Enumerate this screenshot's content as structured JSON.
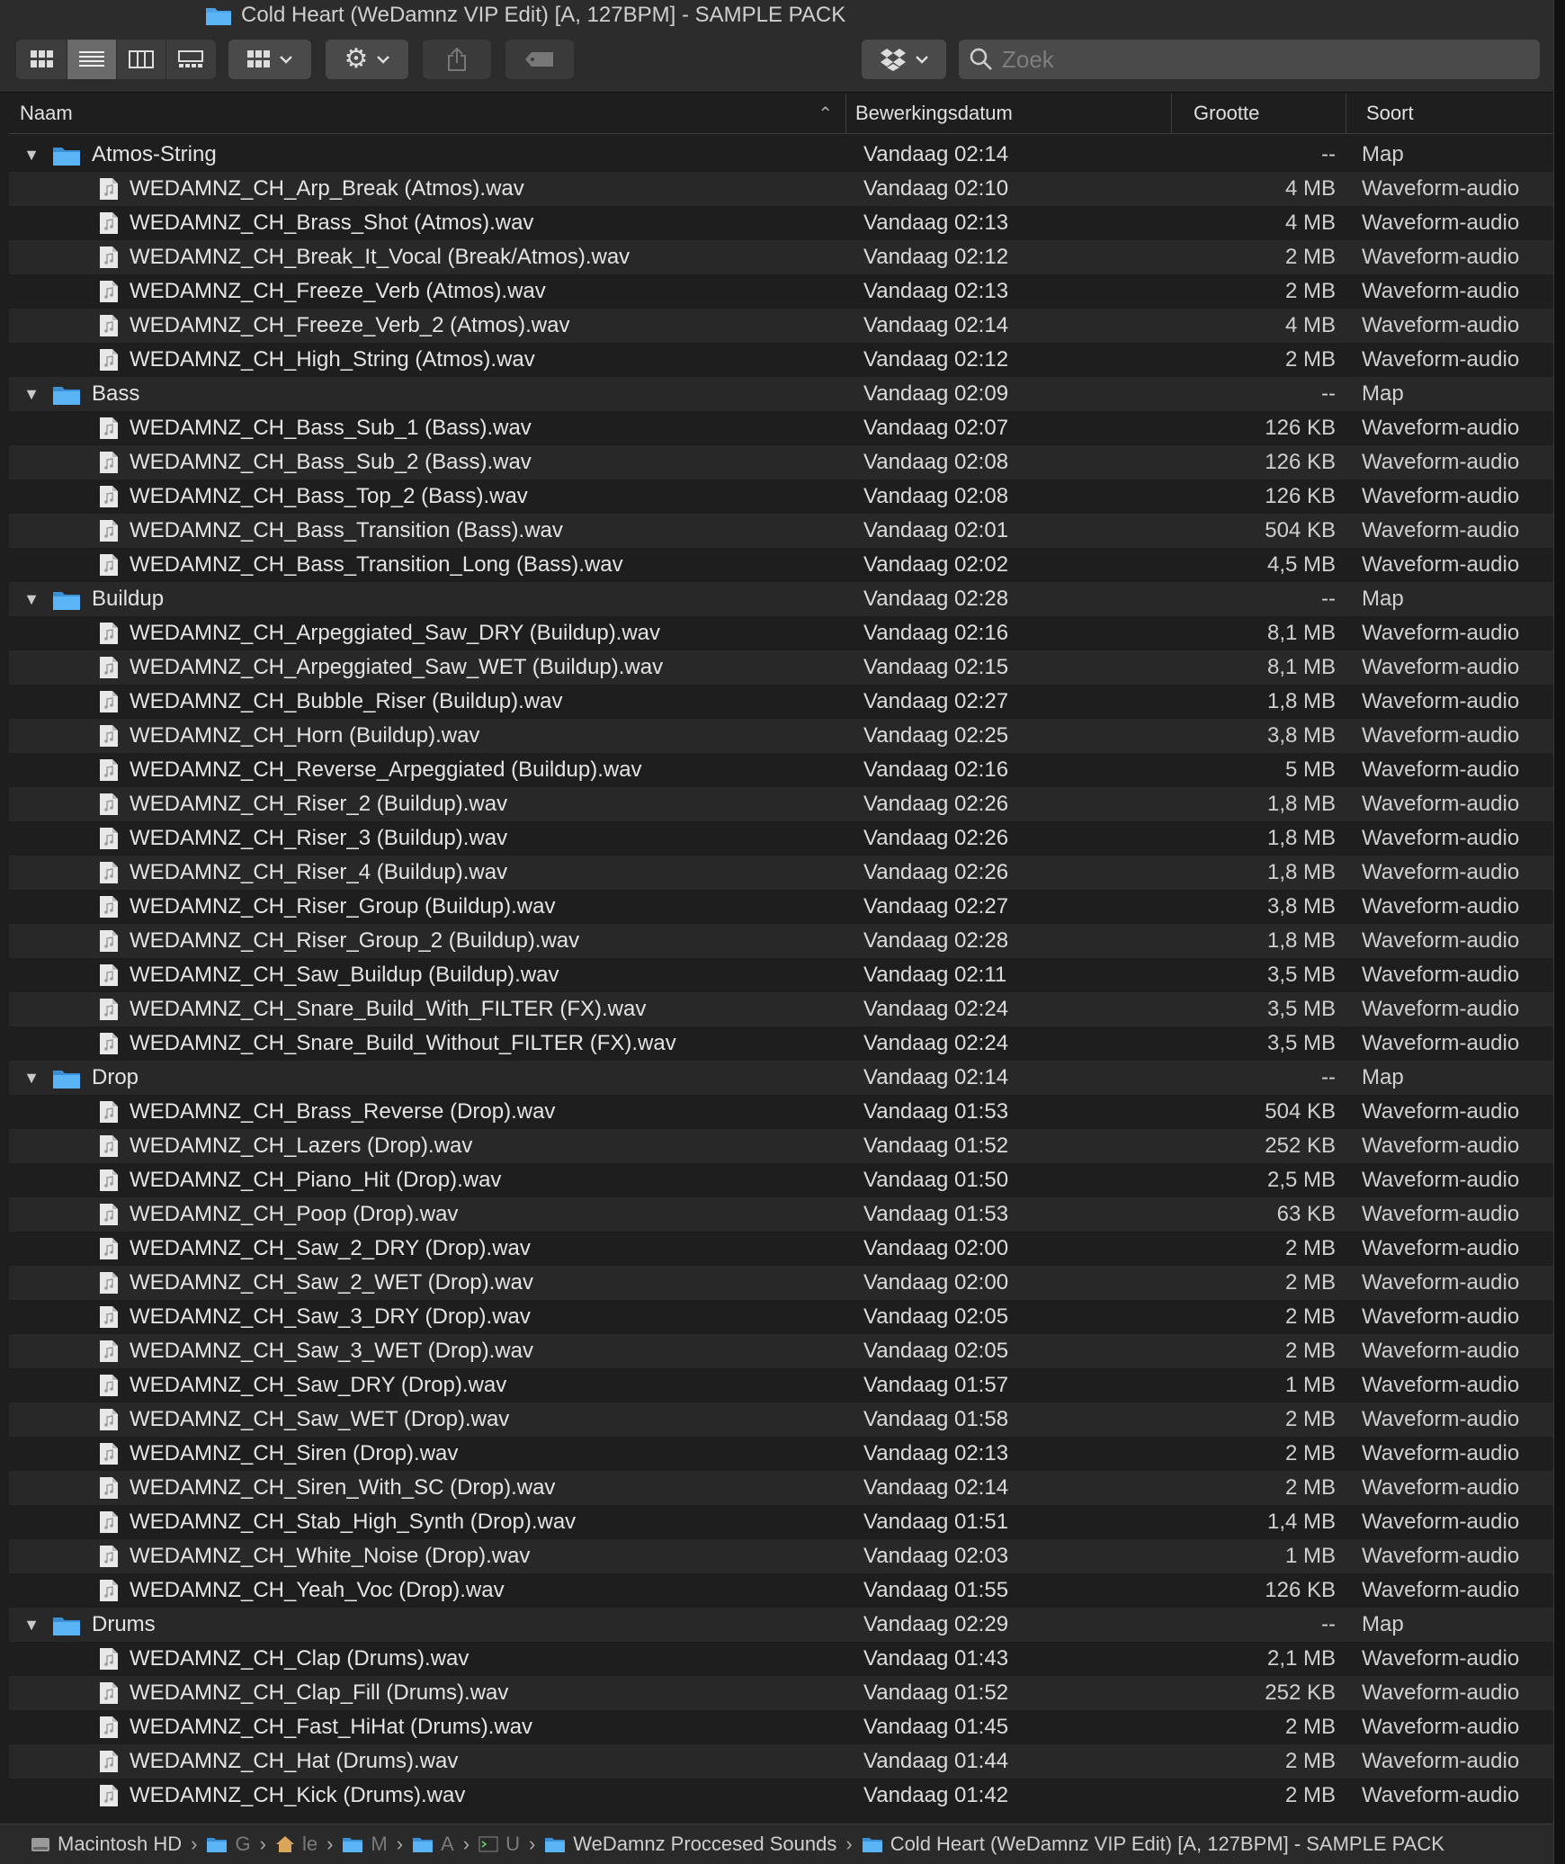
{
  "window": {
    "title": "Cold Heart (WeDamnz VIP Edit) [A, 127BPM] - SAMPLE PACK"
  },
  "toolbar": {
    "view_modes": [
      "icon-view",
      "list-view",
      "column-view",
      "gallery-view"
    ],
    "active_view": "list-view",
    "search_placeholder": "Zoek"
  },
  "columns": {
    "name": "Naam",
    "date": "Bewerkingsdatum",
    "size": "Grootte",
    "kind": "Soort"
  },
  "rows": [
    {
      "type": "folder",
      "name": "Atmos-String",
      "date": "Vandaag 02:14",
      "size": "--",
      "kind": "Map"
    },
    {
      "type": "file",
      "name": "WEDAMNZ_CH_Arp_Break (Atmos).wav",
      "date": "Vandaag 02:10",
      "size": "4 MB",
      "kind": "Waveform-audio"
    },
    {
      "type": "file",
      "name": "WEDAMNZ_CH_Brass_Shot (Atmos).wav",
      "date": "Vandaag 02:13",
      "size": "4 MB",
      "kind": "Waveform-audio"
    },
    {
      "type": "file",
      "name": "WEDAMNZ_CH_Break_It_Vocal (Break/Atmos).wav",
      "date": "Vandaag 02:12",
      "size": "2 MB",
      "kind": "Waveform-audio"
    },
    {
      "type": "file",
      "name": "WEDAMNZ_CH_Freeze_Verb (Atmos).wav",
      "date": "Vandaag 02:13",
      "size": "2 MB",
      "kind": "Waveform-audio"
    },
    {
      "type": "file",
      "name": "WEDAMNZ_CH_Freeze_Verb_2 (Atmos).wav",
      "date": "Vandaag 02:14",
      "size": "4 MB",
      "kind": "Waveform-audio"
    },
    {
      "type": "file",
      "name": "WEDAMNZ_CH_High_String (Atmos).wav",
      "date": "Vandaag 02:12",
      "size": "2 MB",
      "kind": "Waveform-audio"
    },
    {
      "type": "folder",
      "name": "Bass",
      "date": "Vandaag 02:09",
      "size": "--",
      "kind": "Map"
    },
    {
      "type": "file",
      "name": "WEDAMNZ_CH_Bass_Sub_1 (Bass).wav",
      "date": "Vandaag 02:07",
      "size": "126 KB",
      "kind": "Waveform-audio"
    },
    {
      "type": "file",
      "name": "WEDAMNZ_CH_Bass_Sub_2 (Bass).wav",
      "date": "Vandaag 02:08",
      "size": "126 KB",
      "kind": "Waveform-audio"
    },
    {
      "type": "file",
      "name": "WEDAMNZ_CH_Bass_Top_2 (Bass).wav",
      "date": "Vandaag 02:08",
      "size": "126 KB",
      "kind": "Waveform-audio"
    },
    {
      "type": "file",
      "name": "WEDAMNZ_CH_Bass_Transition (Bass).wav",
      "date": "Vandaag 02:01",
      "size": "504 KB",
      "kind": "Waveform-audio"
    },
    {
      "type": "file",
      "name": "WEDAMNZ_CH_Bass_Transition_Long (Bass).wav",
      "date": "Vandaag 02:02",
      "size": "4,5 MB",
      "kind": "Waveform-audio"
    },
    {
      "type": "folder",
      "name": "Buildup",
      "date": "Vandaag 02:28",
      "size": "--",
      "kind": "Map"
    },
    {
      "type": "file",
      "name": "WEDAMNZ_CH_Arpeggiated_Saw_DRY (Buildup).wav",
      "date": "Vandaag 02:16",
      "size": "8,1 MB",
      "kind": "Waveform-audio"
    },
    {
      "type": "file",
      "name": "WEDAMNZ_CH_Arpeggiated_Saw_WET (Buildup).wav",
      "date": "Vandaag 02:15",
      "size": "8,1 MB",
      "kind": "Waveform-audio"
    },
    {
      "type": "file",
      "name": "WEDAMNZ_CH_Bubble_Riser (Buildup).wav",
      "date": "Vandaag 02:27",
      "size": "1,8 MB",
      "kind": "Waveform-audio"
    },
    {
      "type": "file",
      "name": "WEDAMNZ_CH_Horn (Buildup).wav",
      "date": "Vandaag 02:25",
      "size": "3,8 MB",
      "kind": "Waveform-audio"
    },
    {
      "type": "file",
      "name": "WEDAMNZ_CH_Reverse_Arpeggiated (Buildup).wav",
      "date": "Vandaag 02:16",
      "size": "5 MB",
      "kind": "Waveform-audio"
    },
    {
      "type": "file",
      "name": "WEDAMNZ_CH_Riser_2 (Buildup).wav",
      "date": "Vandaag 02:26",
      "size": "1,8 MB",
      "kind": "Waveform-audio"
    },
    {
      "type": "file",
      "name": "WEDAMNZ_CH_Riser_3 (Buildup).wav",
      "date": "Vandaag 02:26",
      "size": "1,8 MB",
      "kind": "Waveform-audio"
    },
    {
      "type": "file",
      "name": "WEDAMNZ_CH_Riser_4 (Buildup).wav",
      "date": "Vandaag 02:26",
      "size": "1,8 MB",
      "kind": "Waveform-audio"
    },
    {
      "type": "file",
      "name": "WEDAMNZ_CH_Riser_Group (Buildup).wav",
      "date": "Vandaag 02:27",
      "size": "3,8 MB",
      "kind": "Waveform-audio"
    },
    {
      "type": "file",
      "name": "WEDAMNZ_CH_Riser_Group_2 (Buildup).wav",
      "date": "Vandaag 02:28",
      "size": "1,8 MB",
      "kind": "Waveform-audio"
    },
    {
      "type": "file",
      "name": "WEDAMNZ_CH_Saw_Buildup (Buildup).wav",
      "date": "Vandaag 02:11",
      "size": "3,5 MB",
      "kind": "Waveform-audio"
    },
    {
      "type": "file",
      "name": "WEDAMNZ_CH_Snare_Build_With_FILTER (FX).wav",
      "date": "Vandaag 02:24",
      "size": "3,5 MB",
      "kind": "Waveform-audio"
    },
    {
      "type": "file",
      "name": "WEDAMNZ_CH_Snare_Build_Without_FILTER (FX).wav",
      "date": "Vandaag 02:24",
      "size": "3,5 MB",
      "kind": "Waveform-audio"
    },
    {
      "type": "folder",
      "name": "Drop",
      "date": "Vandaag 02:14",
      "size": "--",
      "kind": "Map"
    },
    {
      "type": "file",
      "name": "WEDAMNZ_CH_Brass_Reverse (Drop).wav",
      "date": "Vandaag 01:53",
      "size": "504 KB",
      "kind": "Waveform-audio"
    },
    {
      "type": "file",
      "name": "WEDAMNZ_CH_Lazers (Drop).wav",
      "date": "Vandaag 01:52",
      "size": "252 KB",
      "kind": "Waveform-audio"
    },
    {
      "type": "file",
      "name": "WEDAMNZ_CH_Piano_Hit (Drop).wav",
      "date": "Vandaag 01:50",
      "size": "2,5 MB",
      "kind": "Waveform-audio"
    },
    {
      "type": "file",
      "name": "WEDAMNZ_CH_Poop (Drop).wav",
      "date": "Vandaag 01:53",
      "size": "63 KB",
      "kind": "Waveform-audio"
    },
    {
      "type": "file",
      "name": "WEDAMNZ_CH_Saw_2_DRY (Drop).wav",
      "date": "Vandaag 02:00",
      "size": "2 MB",
      "kind": "Waveform-audio"
    },
    {
      "type": "file",
      "name": "WEDAMNZ_CH_Saw_2_WET (Drop).wav",
      "date": "Vandaag 02:00",
      "size": "2 MB",
      "kind": "Waveform-audio"
    },
    {
      "type": "file",
      "name": "WEDAMNZ_CH_Saw_3_DRY (Drop).wav",
      "date": "Vandaag 02:05",
      "size": "2 MB",
      "kind": "Waveform-audio"
    },
    {
      "type": "file",
      "name": "WEDAMNZ_CH_Saw_3_WET (Drop).wav",
      "date": "Vandaag 02:05",
      "size": "2 MB",
      "kind": "Waveform-audio"
    },
    {
      "type": "file",
      "name": "WEDAMNZ_CH_Saw_DRY (Drop).wav",
      "date": "Vandaag 01:57",
      "size": "1 MB",
      "kind": "Waveform-audio"
    },
    {
      "type": "file",
      "name": "WEDAMNZ_CH_Saw_WET (Drop).wav",
      "date": "Vandaag 01:58",
      "size": "2 MB",
      "kind": "Waveform-audio"
    },
    {
      "type": "file",
      "name": "WEDAMNZ_CH_Siren (Drop).wav",
      "date": "Vandaag 02:13",
      "size": "2 MB",
      "kind": "Waveform-audio"
    },
    {
      "type": "file",
      "name": "WEDAMNZ_CH_Siren_With_SC (Drop).wav",
      "date": "Vandaag 02:14",
      "size": "2 MB",
      "kind": "Waveform-audio"
    },
    {
      "type": "file",
      "name": "WEDAMNZ_CH_Stab_High_Synth (Drop).wav",
      "date": "Vandaag 01:51",
      "size": "1,4 MB",
      "kind": "Waveform-audio"
    },
    {
      "type": "file",
      "name": "WEDAMNZ_CH_White_Noise (Drop).wav",
      "date": "Vandaag 02:03",
      "size": "1 MB",
      "kind": "Waveform-audio"
    },
    {
      "type": "file",
      "name": "WEDAMNZ_CH_Yeah_Voc (Drop).wav",
      "date": "Vandaag 01:55",
      "size": "126 KB",
      "kind": "Waveform-audio"
    },
    {
      "type": "folder",
      "name": "Drums",
      "date": "Vandaag 02:29",
      "size": "--",
      "kind": "Map"
    },
    {
      "type": "file",
      "name": "WEDAMNZ_CH_Clap (Drums).wav",
      "date": "Vandaag 01:43",
      "size": "2,1 MB",
      "kind": "Waveform-audio"
    },
    {
      "type": "file",
      "name": "WEDAMNZ_CH_Clap_Fill (Drums).wav",
      "date": "Vandaag 01:52",
      "size": "252 KB",
      "kind": "Waveform-audio"
    },
    {
      "type": "file",
      "name": "WEDAMNZ_CH_Fast_HiHat (Drums).wav",
      "date": "Vandaag 01:45",
      "size": "2 MB",
      "kind": "Waveform-audio"
    },
    {
      "type": "file",
      "name": "WEDAMNZ_CH_Hat (Drums).wav",
      "date": "Vandaag 01:44",
      "size": "2 MB",
      "kind": "Waveform-audio"
    },
    {
      "type": "file",
      "name": "WEDAMNZ_CH_Kick (Drums).wav",
      "date": "Vandaag 01:42",
      "size": "2 MB",
      "kind": "Waveform-audio"
    }
  ],
  "pathbar": [
    {
      "label": "Macintosh HD",
      "icon": "harddisk-icon",
      "dim": false
    },
    {
      "label": "G",
      "icon": "folder-icon",
      "dim": true
    },
    {
      "label": "le",
      "icon": "home-icon",
      "dim": true
    },
    {
      "label": "M",
      "icon": "folder-icon",
      "dim": true
    },
    {
      "label": "A",
      "icon": "folder-icon",
      "dim": true
    },
    {
      "label": "U",
      "icon": "terminal-folder-icon",
      "dim": true
    },
    {
      "label": "WeDamnz Proccesed Sounds",
      "icon": "folder-icon",
      "dim": false
    },
    {
      "label": "Cold Heart (WeDamnz VIP Edit) [A, 127BPM] - SAMPLE PACK",
      "icon": "folder-icon",
      "dim": false
    }
  ],
  "colors": {
    "folder": "#4aa3e8",
    "background": "#1e1e1e",
    "row_alt": "#282828"
  }
}
